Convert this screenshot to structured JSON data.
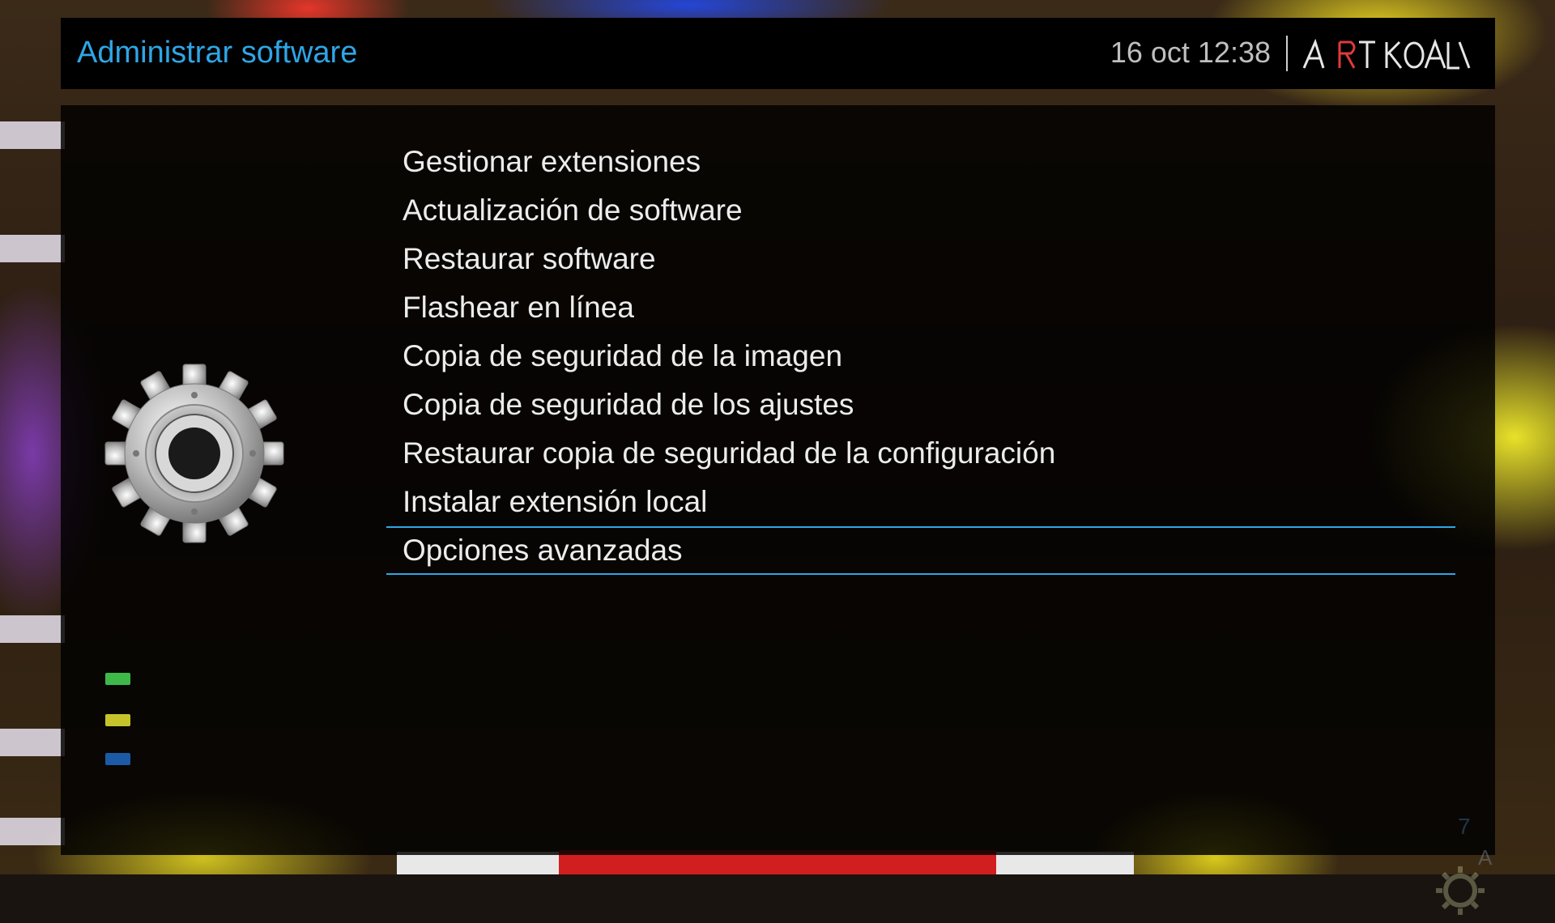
{
  "header": {
    "title": "Administrar software",
    "clock": "16 oct 12:38",
    "brand_logo_text": "ART KOALA"
  },
  "menu": {
    "items": [
      {
        "label": "Gestionar extensiones"
      },
      {
        "label": "Actualización de software"
      },
      {
        "label": "Restaurar software"
      },
      {
        "label": "Flashear en línea"
      },
      {
        "label": "Copia de seguridad de la imagen"
      },
      {
        "label": "Copia de seguridad de los ajustes"
      },
      {
        "label": "Restaurar copia de seguridad de la configuración"
      },
      {
        "label": "Instalar extensión local"
      },
      {
        "label": "Opciones avanzadas"
      }
    ],
    "selected_index": 8
  },
  "side_icon": "gear-icon",
  "color_keys": [
    "#3fb84a",
    "#c6c42a",
    "#1b5aa5"
  ],
  "accent_color": "#2ea6e6",
  "channel_watermark": {
    "number": "7",
    "letter": "A"
  }
}
